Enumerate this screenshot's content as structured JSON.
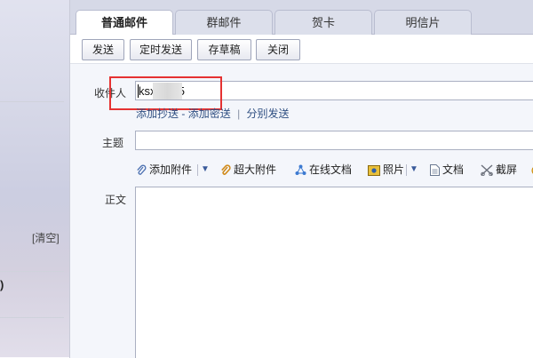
{
  "sidebar": {
    "clear_label": "[清空]",
    "partial_text": ")"
  },
  "tabs": [
    {
      "label": "普通邮件",
      "active": true
    },
    {
      "label": "群邮件",
      "active": false
    },
    {
      "label": "贺卡",
      "active": false
    },
    {
      "label": "明信片",
      "active": false
    }
  ],
  "toolbar": {
    "send_label": "发送",
    "scheduled_send_label": "定时发送",
    "save_draft_label": "存草稿",
    "close_label": "关闭"
  },
  "compose": {
    "to_label": "收件人",
    "to_value": "ksx      0205",
    "recipient_links": {
      "add_cc": "添加抄送",
      "dash": "-",
      "add_bcc": "添加密送",
      "separator": "|",
      "send_separately": "分别发送"
    },
    "subject_label": "主题",
    "subject_value": "",
    "body_label": "正文"
  },
  "attach_bar": {
    "add_attachment": "添加附件",
    "large_attachment": "超大附件",
    "online_doc": "在线文档",
    "photo": "照片",
    "document": "文档",
    "screenshot": "截屏"
  },
  "colors": {
    "highlight_box": "#e53232",
    "link": "#2f4f82"
  }
}
